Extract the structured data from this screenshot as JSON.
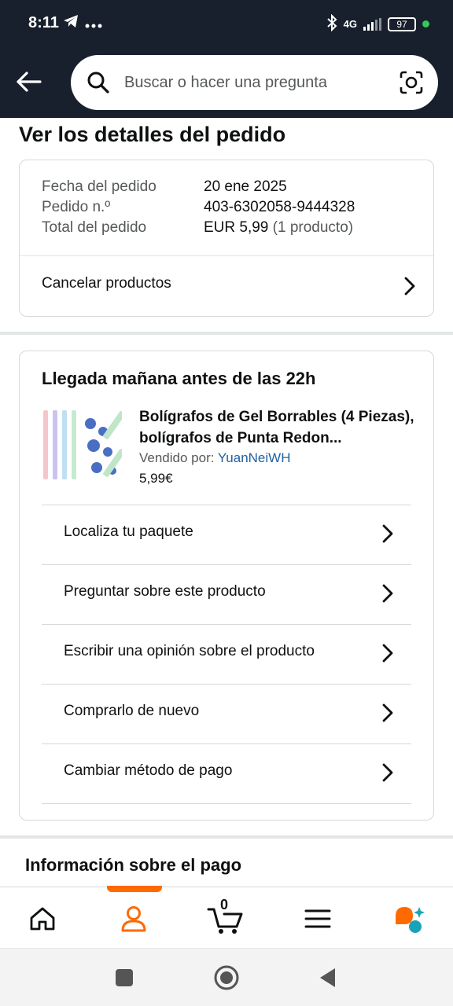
{
  "status_bar": {
    "time": "8:11",
    "telegram_icon": "telegram-icon",
    "more_icon": "more-dots-icon",
    "network": "4G",
    "battery": "97"
  },
  "header": {
    "back_icon": "arrow-left-icon",
    "search_placeholder": "Buscar o hacer una pregunta",
    "search_icon": "search-icon",
    "camera_icon": "camera-scan-icon"
  },
  "page": {
    "title": "Ver los detalles del pedido"
  },
  "order_summary": {
    "date_label": "Fecha del pedido",
    "date_value": "20 ene 2025",
    "order_label": "Pedido n.º",
    "order_value": "403-6302058-9444328",
    "total_label": "Total del pedido",
    "total_value": "EUR 5,99",
    "total_note": "(1 producto)",
    "cancel_label": "Cancelar productos"
  },
  "shipment": {
    "arrival": "Llegada mañana antes de las 22h",
    "product_title": "Bolígrafos de Gel Borrables (4 Piezas), bolígrafos de Punta Redon...",
    "sold_by_label": "Vendido por:",
    "seller": "YuanNeiWH",
    "price": "5,99€",
    "actions": [
      {
        "label": "Localiza tu paquete"
      },
      {
        "label": "Preguntar sobre este producto"
      },
      {
        "label": "Escribir una opinión sobre el producto"
      },
      {
        "label": "Comprarlo de nuevo"
      },
      {
        "label": "Cambiar método de pago"
      }
    ]
  },
  "payment": {
    "title": "Información sobre el pago"
  },
  "bottom_nav": {
    "items": [
      "home-icon",
      "account-icon",
      "cart-icon",
      "menu-icon",
      "rufus-icon"
    ],
    "cart_count": "0",
    "active": "account",
    "accent_color": "#ff6a00"
  },
  "system_nav": [
    "recents-icon",
    "home-circle-icon",
    "back-triangle-icon"
  ]
}
